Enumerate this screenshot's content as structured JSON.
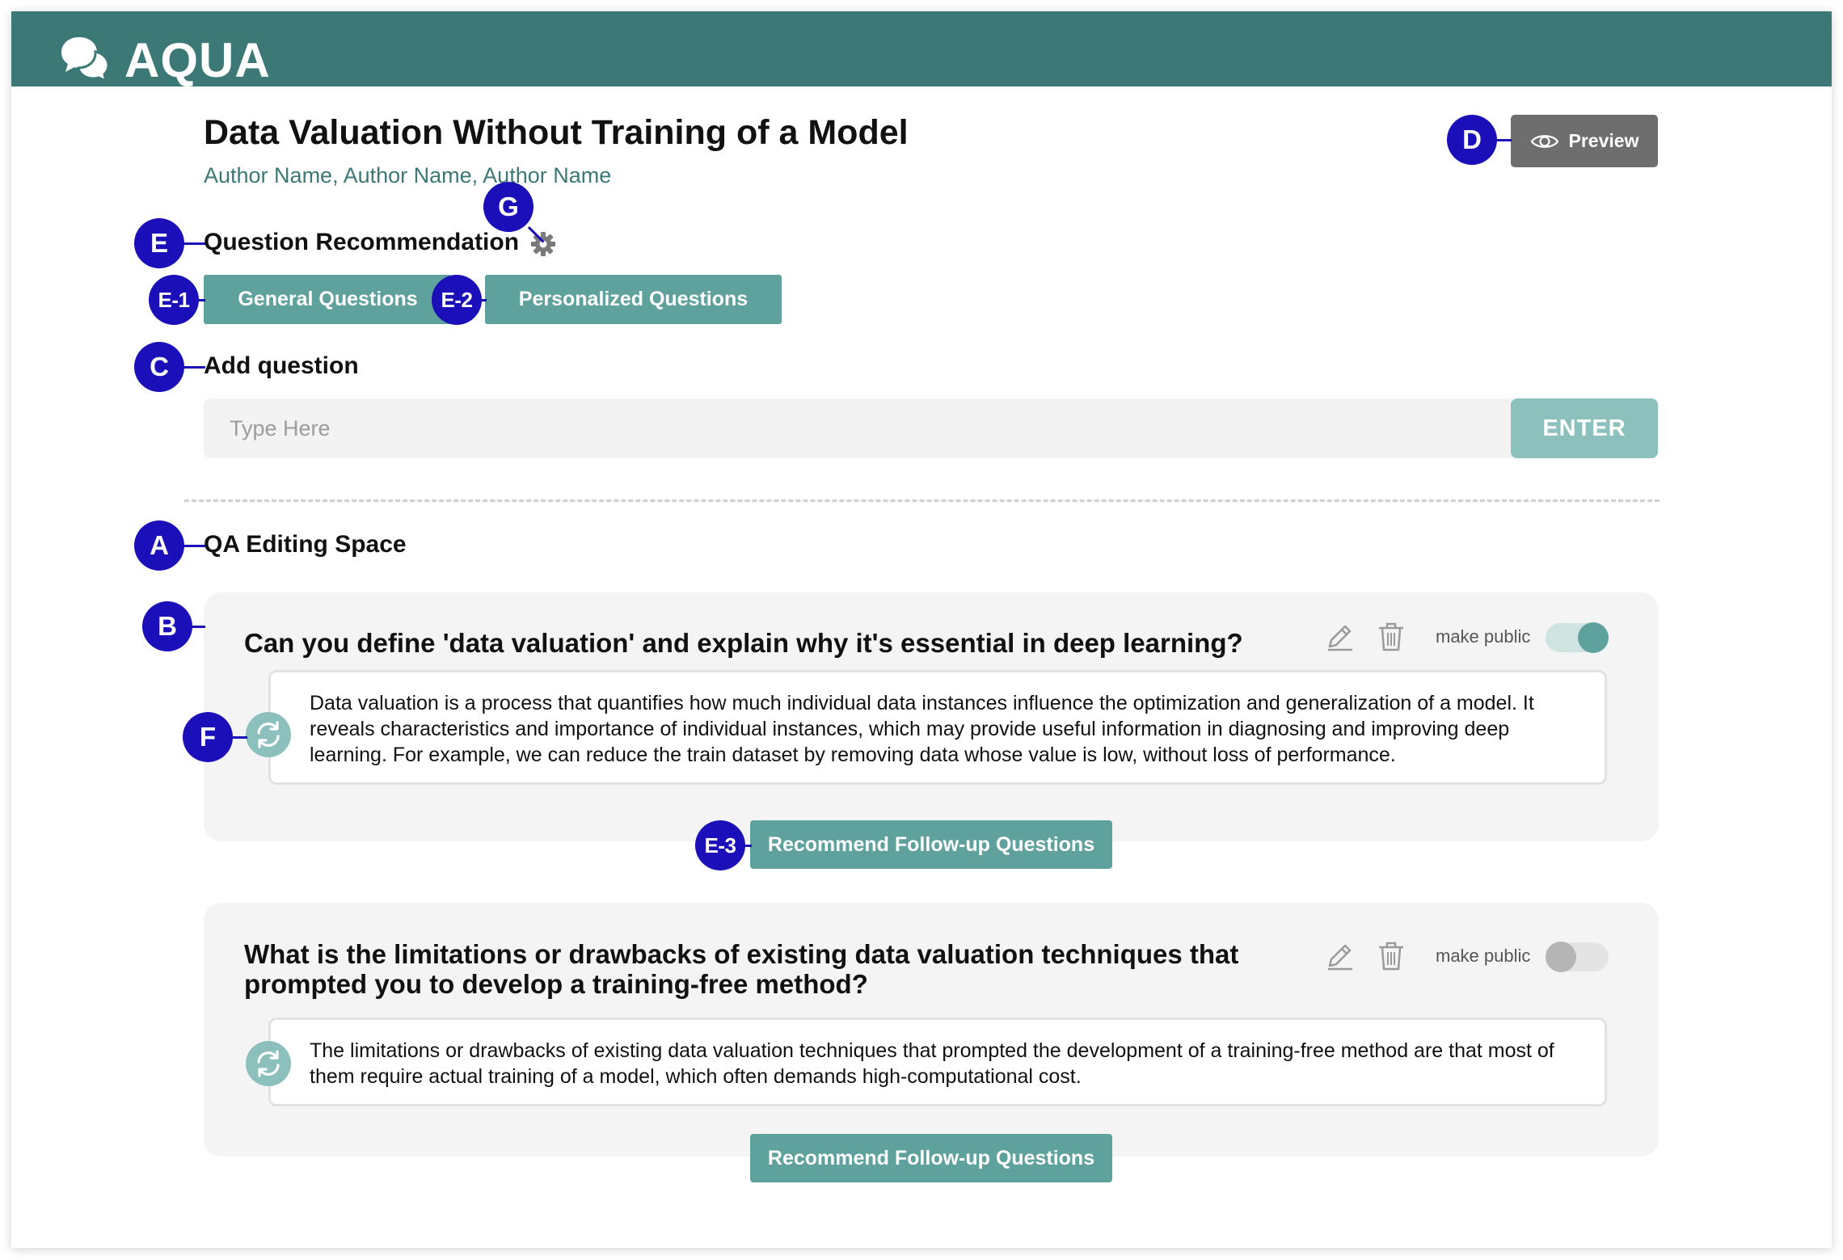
{
  "app": {
    "brand": "AQUA"
  },
  "header": {
    "paper_title": "Data Valuation Without Training of a Model",
    "authors": "Author Name, Author Name, Author Name",
    "preview_label": "Preview"
  },
  "question_recommendation": {
    "heading": "Question Recommendation",
    "general_label": "General Questions",
    "personalized_label": "Personalized Questions"
  },
  "add_question": {
    "heading": "Add question",
    "placeholder": "Type Here",
    "enter_label": "ENTER"
  },
  "qa_space": {
    "heading": "QA Editing Space",
    "make_public_label": "make public",
    "followup_label": "Recommend Follow-up Questions",
    "items": [
      {
        "question": "Can you define 'data valuation' and explain why it's essential in deep learning?",
        "answer": "Data valuation is a process that quantifies how much individual data instances influence the optimization and generalization of a model. It reveals characteristics and importance of individual instances, which may provide useful information in diagnosing and improving deep learning. For example, we can reduce the train dataset by removing data whose value is low, without loss of performance.",
        "public": true
      },
      {
        "question": "What is the limitations or drawbacks of existing data valuation techniques that prompted you to develop a training-free method?",
        "answer": "The limitations or drawbacks of existing data valuation techniques that prompted the development of a training-free method are that most of them require actual training of a model, which often demands high-computational cost.",
        "public": false
      }
    ]
  },
  "annotations": {
    "A": "A",
    "B": "B",
    "C": "C",
    "D": "D",
    "E": "E",
    "E1": "E-1",
    "E2": "E-2",
    "E3": "E-3",
    "F": "F",
    "G": "G"
  },
  "colors": {
    "topbar": "#3c7876",
    "accent": "#5fa19c",
    "accent_light": "#8cc0bc",
    "marker": "#1a0fb8",
    "preview_bg": "#6e6e6e"
  }
}
